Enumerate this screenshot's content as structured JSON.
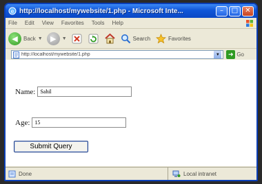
{
  "window": {
    "title": "http://localhost/mywebsite/1.php - Microsoft Inte...",
    "minimize_glyph": "–",
    "maximize_glyph": "□",
    "close_glyph": "✕"
  },
  "menu": {
    "items": [
      "File",
      "Edit",
      "View",
      "Favorites",
      "Tools",
      "Help"
    ]
  },
  "toolbar": {
    "back_label": "Back",
    "search_label": "Search",
    "favorites_label": "Favorites"
  },
  "address": {
    "label": "",
    "url": "http://localhost/mywebsite/1.php",
    "go_label": "Go",
    "links_label": ""
  },
  "form": {
    "name_label": "Name:",
    "name_value": "Sahil",
    "age_label": "Age:",
    "age_value": "15",
    "submit_label": "Submit Query"
  },
  "status": {
    "text": "Done",
    "zone_text": "Local intranet"
  },
  "icons": {
    "browser": "ie-logo-icon",
    "back": "back-arrow-icon",
    "forward": "forward-arrow-icon",
    "stop": "stop-icon",
    "refresh": "refresh-icon",
    "home": "home-icon",
    "search": "search-icon",
    "favorites": "favorites-star-icon",
    "windows": "windows-logo-icon",
    "page": "page-icon",
    "go": "go-arrow-icon",
    "zone": "intranet-icon"
  },
  "colors": {
    "titlebar": "#0f56d8",
    "chrome": "#ece9d8",
    "close": "#c64423",
    "go": "#2f9a22"
  }
}
